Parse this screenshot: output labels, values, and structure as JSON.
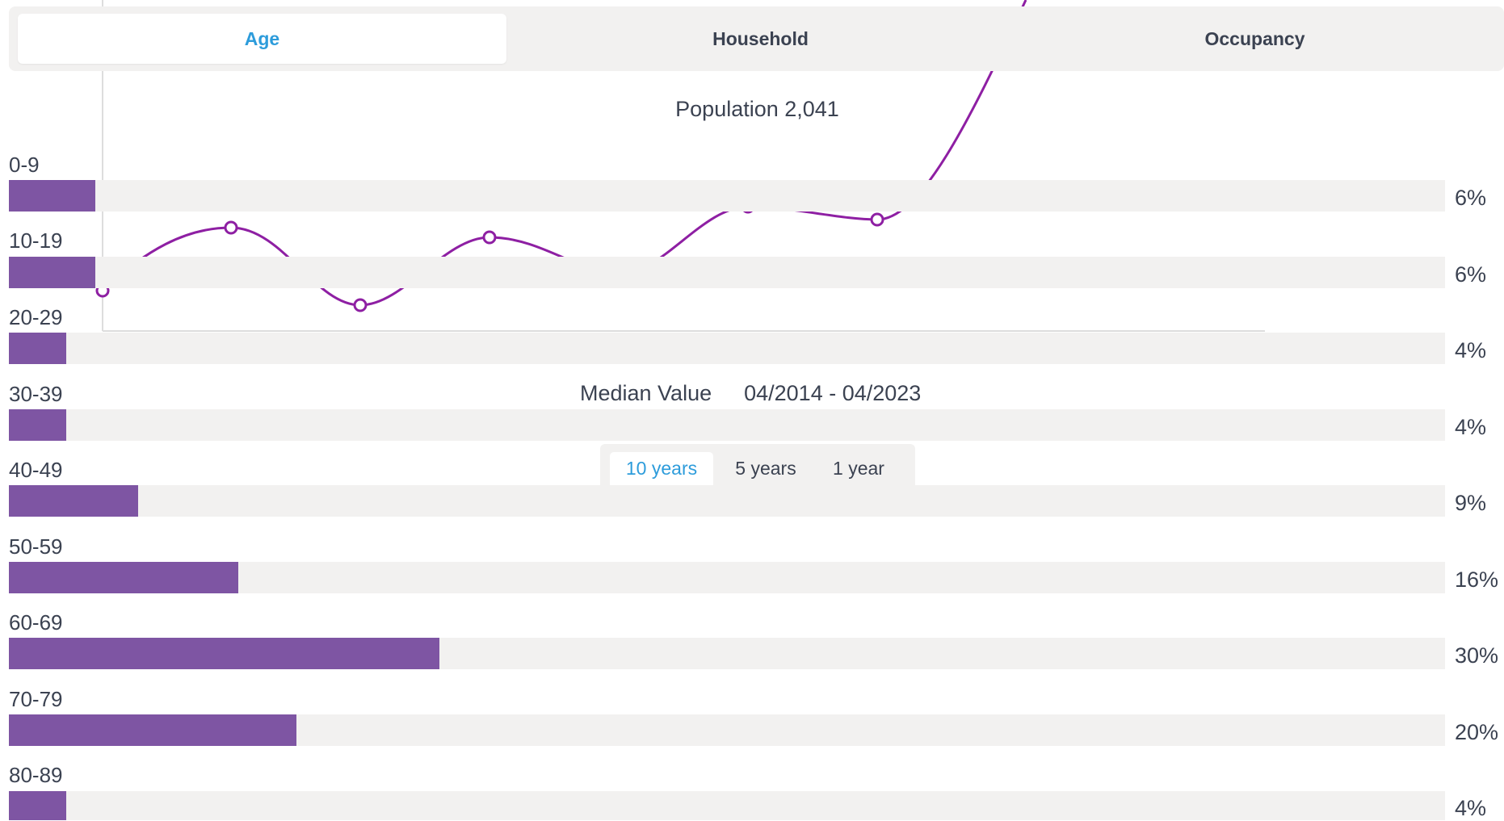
{
  "tabs": [
    {
      "label": "Age",
      "active": true
    },
    {
      "label": "Household",
      "active": false
    },
    {
      "label": "Occupancy",
      "active": false
    }
  ],
  "population_title": "Population 2,041",
  "age_groups": [
    {
      "label": "0-9",
      "percent_label": "6%",
      "value": 6
    },
    {
      "label": "10-19",
      "percent_label": "6%",
      "value": 6
    },
    {
      "label": "20-29",
      "percent_label": "4%",
      "value": 4
    },
    {
      "label": "30-39",
      "percent_label": "4%",
      "value": 4
    },
    {
      "label": "40-49",
      "percent_label": "9%",
      "value": 9
    },
    {
      "label": "50-59",
      "percent_label": "16%",
      "value": 16
    },
    {
      "label": "60-69",
      "percent_label": "30%",
      "value": 30
    },
    {
      "label": "70-79",
      "percent_label": "20%",
      "value": 20
    },
    {
      "label": "80-89",
      "percent_label": "4%",
      "value": 4
    }
  ],
  "median": {
    "label": "Median Value",
    "range": "04/2014 - 04/2023"
  },
  "periods": [
    {
      "label": "10 years",
      "active": true
    },
    {
      "label": "5 years",
      "active": false
    },
    {
      "label": "1 year",
      "active": false
    }
  ],
  "colors": {
    "bar_fill": "#7e55a3",
    "bar_track": "#f2f1f0",
    "accent": "#2d9cdb",
    "line": "#8e1fa3",
    "text": "#3b4251"
  }
}
